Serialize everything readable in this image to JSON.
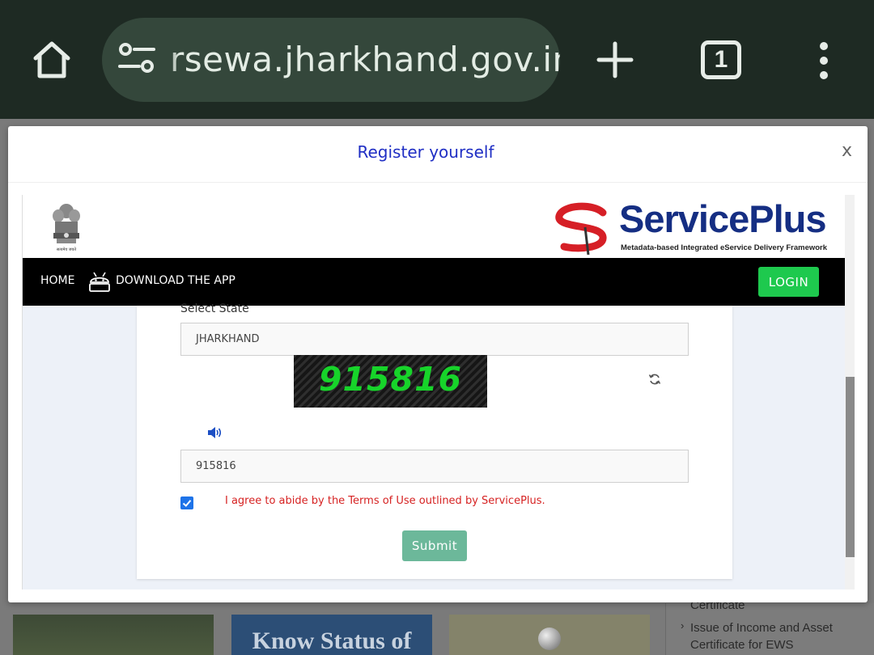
{
  "browser": {
    "url": "rsewa.jharkhand.gov.in",
    "tab_count": "1"
  },
  "background": {
    "sidebar_item_partial": "Certificate",
    "sidebar_item": "Issue of Income and Asset Certificate for EWS",
    "card_text": "Know Status of"
  },
  "modal": {
    "title": "Register yourself",
    "close_label": "x"
  },
  "header": {
    "emblem_caption": "सत्यमेव जयते",
    "brand_name": "ServicePlus",
    "brand_tagline": "Metadata-based Integrated eService Delivery Framework"
  },
  "nav": {
    "home": "HOME",
    "download_app": "DOWNLOAD THE APP",
    "login": "LOGIN"
  },
  "form": {
    "state_label": "Select State",
    "state_value": "JHARKHAND",
    "captcha_text": "915816",
    "captcha_input_value": "915816",
    "agree_checked": true,
    "agree_text": "I agree to abide by the Terms of Use outlined by ServicePlus.",
    "submit": "Submit"
  },
  "colors": {
    "modal_title": "#1f2ec4",
    "login_button": "#1ec94e",
    "submit_button": "#6cb89a",
    "agree_text": "#d62222",
    "captcha_digits": "#17d42a",
    "brand_blue": "#152e83",
    "brand_red": "#d61f26"
  }
}
